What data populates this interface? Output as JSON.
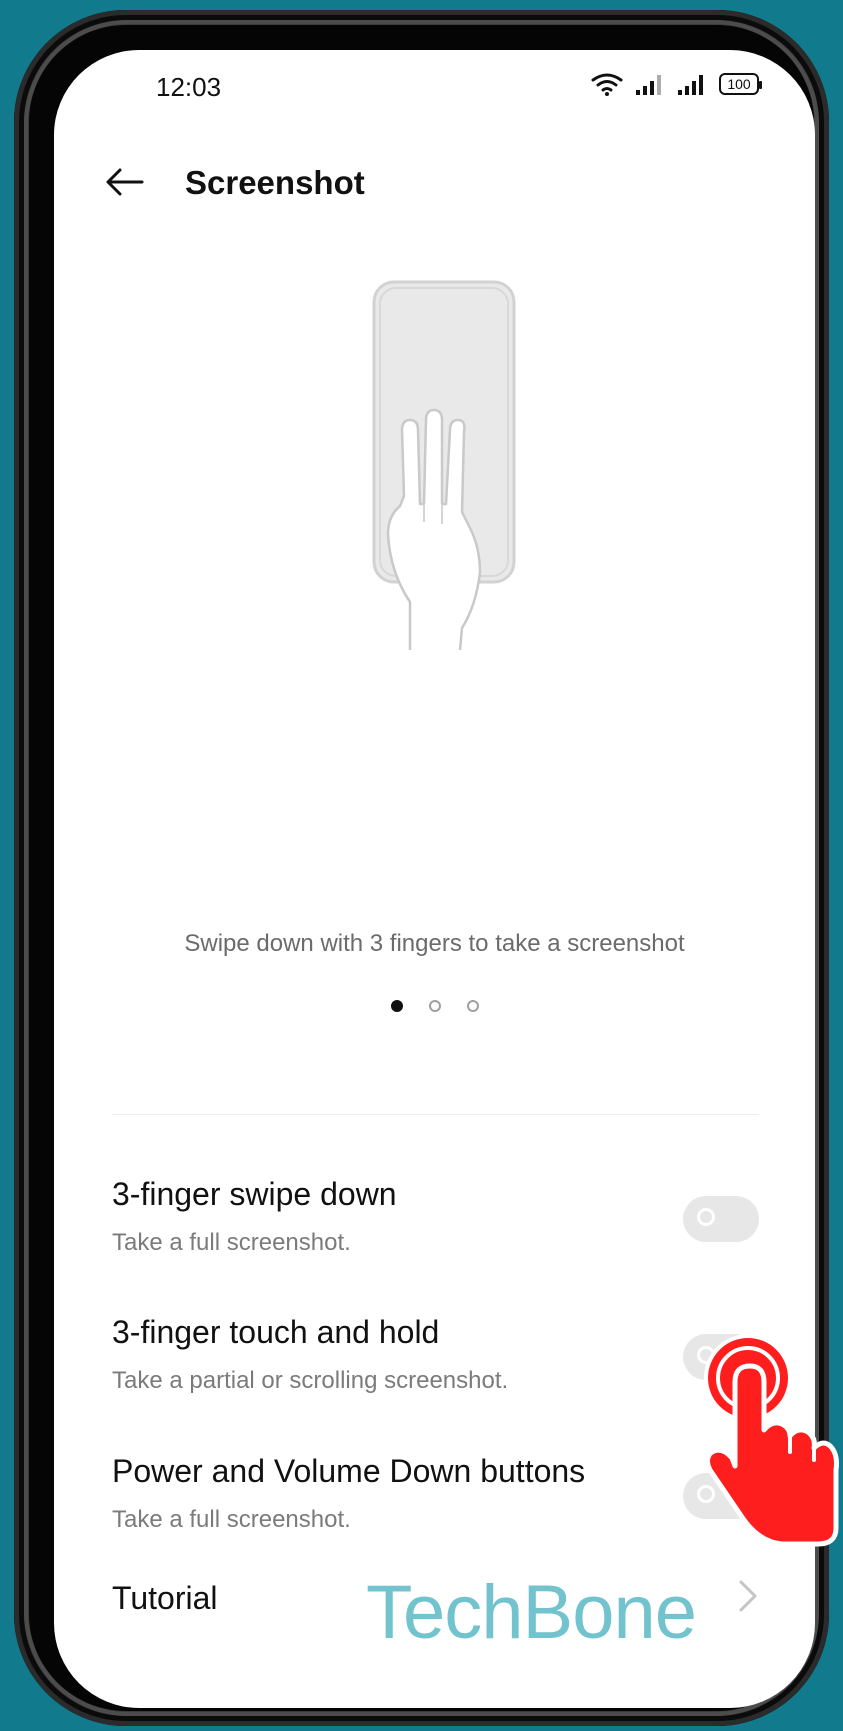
{
  "status_bar": {
    "time": "12:03",
    "battery": "100"
  },
  "header": {
    "title": "Screenshot"
  },
  "illustration": {
    "caption": "Swipe down with 3 fingers to take a screenshot",
    "pages": 3,
    "active_page": 1
  },
  "settings": [
    {
      "title": "3-finger swipe down",
      "subtitle": "Take a full screenshot.",
      "enabled": false
    },
    {
      "title": "3-finger touch and hold",
      "subtitle": "Take a partial or scrolling screenshot.",
      "enabled": false
    },
    {
      "title": "Power and Volume Down buttons",
      "subtitle": "Take a full screenshot.",
      "enabled": false
    }
  ],
  "tutorial": {
    "label": "Tutorial"
  },
  "watermark": "TechBone",
  "colors": {
    "background": "#127a8d",
    "watermark": "#72c3ce",
    "tap_hand": "#ff1e1e",
    "toggle_off": "#e7e7e7"
  },
  "icons": {
    "back": "arrow-left-icon",
    "wifi": "wifi-icon",
    "signal": "signal-bars-icon",
    "chevron": "chevron-right-icon",
    "tap": "tap-hand-icon"
  }
}
